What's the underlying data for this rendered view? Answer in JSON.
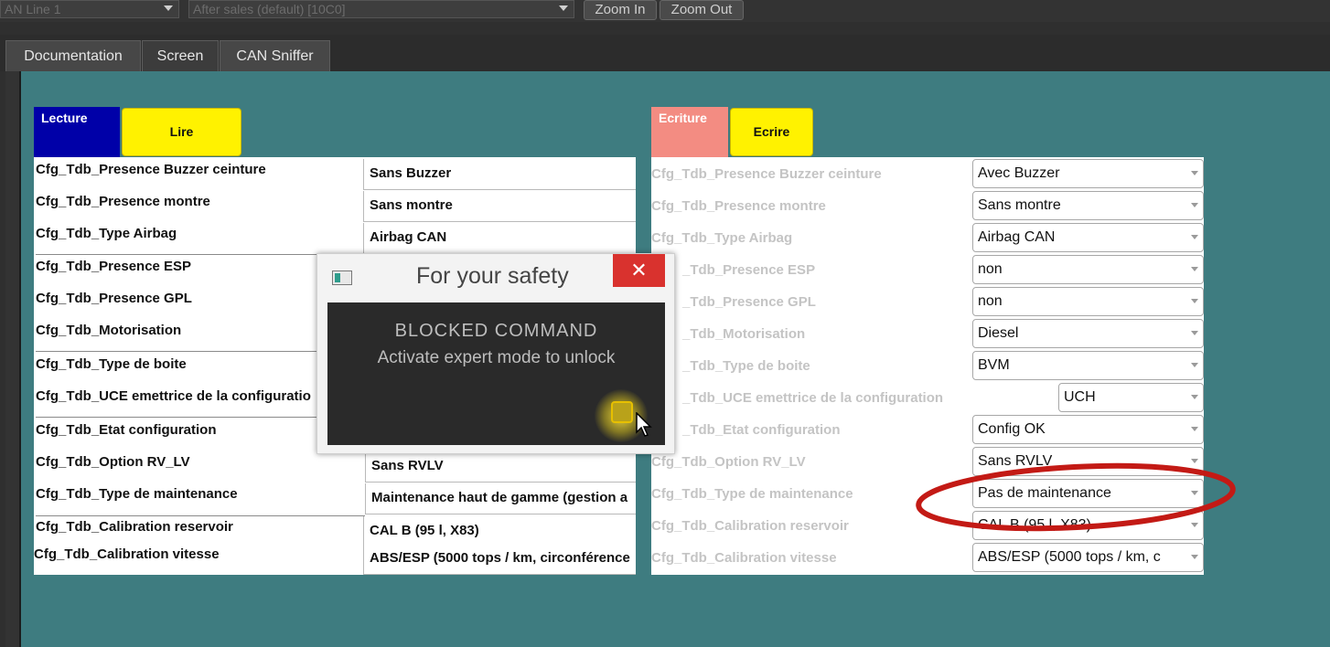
{
  "toolbar": {
    "combo1": "AN Line 1",
    "combo2": "After sales (default) [10C0]",
    "zoom_in": "Zoom In",
    "zoom_out": "Zoom Out"
  },
  "tabs": [
    "Documentation",
    "Screen",
    "CAN Sniffer"
  ],
  "colors": {
    "teal": "#3e7c80",
    "lecture_header": "#0000a8",
    "ecriture_header": "#f38c82",
    "yellow_button": "#fff200",
    "annotation_red": "#c31a15"
  },
  "lecture": {
    "header": "Lecture",
    "button": "Lire",
    "rows": [
      {
        "label": "Cfg_Tdb_Presence Buzzer ceinture",
        "value": "Sans Buzzer"
      },
      {
        "label": "Cfg_Tdb_Presence montre",
        "value": "Sans montre"
      },
      {
        "label": "Cfg_Tdb_Type Airbag",
        "value": "Airbag CAN"
      },
      {
        "label": "Cfg_Tdb_Presence ESP",
        "value": ""
      },
      {
        "label": "Cfg_Tdb_Presence GPL",
        "value": ""
      },
      {
        "label": "Cfg_Tdb_Motorisation",
        "value": ""
      },
      {
        "label": "Cfg_Tdb_Type de boite",
        "value": ""
      },
      {
        "label": "Cfg_Tdb_UCE emettrice de la configuratio",
        "value": ""
      },
      {
        "label": "Cfg_Tdb_Etat configuration",
        "value": ""
      },
      {
        "label": "Cfg_Tdb_Option RV_LV",
        "value": "Sans RVLV"
      },
      {
        "label": "Cfg_Tdb_Type de maintenance",
        "value": "Maintenance haut de gamme (gestion a"
      },
      {
        "label": "Cfg_Tdb_Calibration reservoir",
        "value": "CAL B (95 l, X83)"
      },
      {
        "label": "Cfg_Tdb_Calibration vitesse",
        "value": "ABS/ESP (5000 tops / km, circonférence"
      }
    ]
  },
  "ecriture": {
    "header": "Ecriture",
    "button": "Ecrire",
    "rows": [
      {
        "label": "Cfg_Tdb_Presence Buzzer ceinture",
        "value": "Avec Buzzer"
      },
      {
        "label": "Cfg_Tdb_Presence montre",
        "value": "Sans montre"
      },
      {
        "label": "Cfg_Tdb_Type Airbag",
        "value": "Airbag CAN"
      },
      {
        "label": "_Tdb_Presence ESP",
        "value": "non"
      },
      {
        "label": "_Tdb_Presence GPL",
        "value": "non"
      },
      {
        "label": "_Tdb_Motorisation",
        "value": "Diesel"
      },
      {
        "label": "_Tdb_Type de boite",
        "value": "BVM"
      },
      {
        "label": "_Tdb_UCE emettrice de la configuration",
        "value": "UCH"
      },
      {
        "label": "_Tdb_Etat configuration",
        "value": "Config OK"
      },
      {
        "label": "Cfg_Tdb_Option RV_LV",
        "value": "Sans RVLV"
      },
      {
        "label": "Cfg_Tdb_Type de maintenance",
        "value": "Pas de maintenance"
      },
      {
        "label": "Cfg_Tdb_Calibration reservoir",
        "value": "CAL B (95 l, X83)"
      },
      {
        "label": "Cfg_Tdb_Calibration vitesse",
        "value": "ABS/ESP (5000 tops / km, c"
      }
    ]
  },
  "dialog": {
    "title": "For your safety",
    "close": "✕",
    "line1": "BLOCKED COMMAND",
    "line2": "Activate expert mode to unlock"
  }
}
